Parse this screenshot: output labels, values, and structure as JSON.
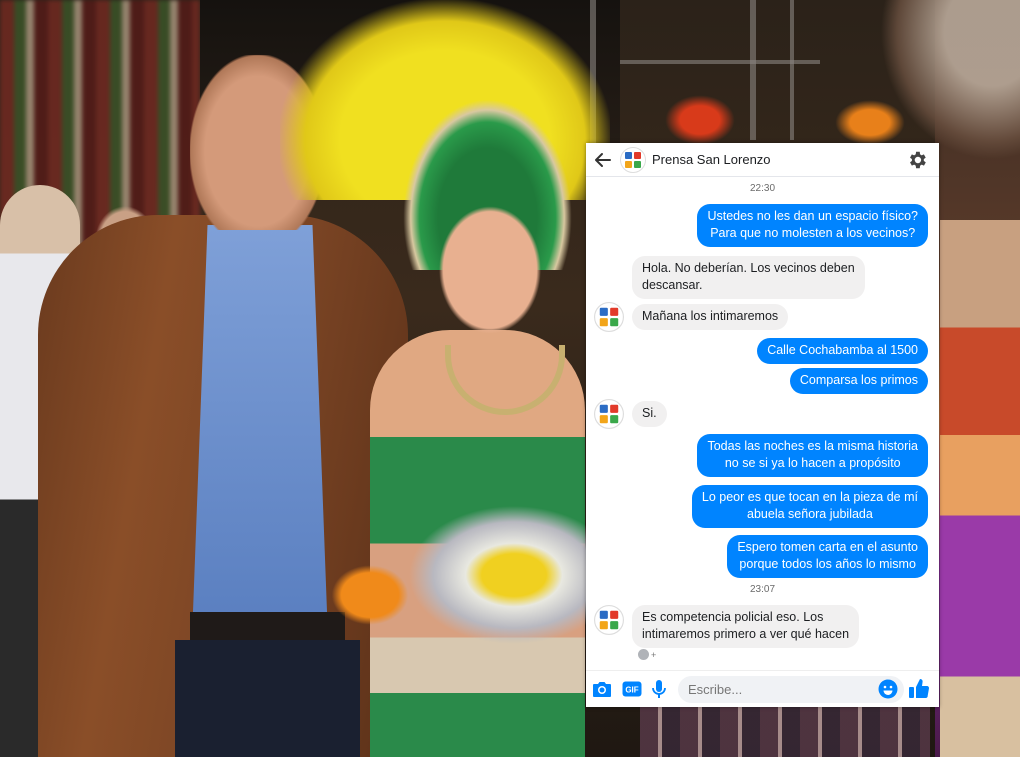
{
  "header": {
    "title": "Prensa San Lorenzo"
  },
  "timestamps": [
    "22:30",
    "23:07"
  ],
  "messages": [
    {
      "side": "out",
      "text": "Ustedes no les dan un espacio físico?\nPara que no molesten a los vecinos?"
    },
    {
      "side": "in",
      "text": "Hola. No deberían.  Los vecinos deben\ndescansar."
    },
    {
      "side": "in",
      "text": "Mañana los intimaremos"
    },
    {
      "side": "out",
      "text": "Calle Cochabamba al 1500"
    },
    {
      "side": "out",
      "text": "Comparsa los primos"
    },
    {
      "side": "in",
      "text": "Si."
    },
    {
      "side": "out",
      "text": "Todas las noches es la misma historia\nno se si ya lo hacen a propósito"
    },
    {
      "side": "out",
      "text": "Lo peor es que tocan en la pieza de mí\nabuela señora jubilada"
    },
    {
      "side": "out",
      "text": "Espero tomen carta en el asunto\nporque todos los años lo mismo"
    },
    {
      "side": "in",
      "text": "Es competencia policial eso.  Los\nintimaremos primero a ver qué hacen"
    }
  ],
  "reaction": "+",
  "composer": {
    "placeholder": "Escribe...",
    "gif_label": "GIF"
  },
  "colors": {
    "accent": "#0084ff",
    "incoming_bubble": "#f1f0f0"
  },
  "icons": [
    "back-arrow-icon",
    "gear-icon",
    "camera-icon",
    "gif-icon",
    "microphone-icon",
    "emoji-icon",
    "thumbs-up-icon"
  ]
}
